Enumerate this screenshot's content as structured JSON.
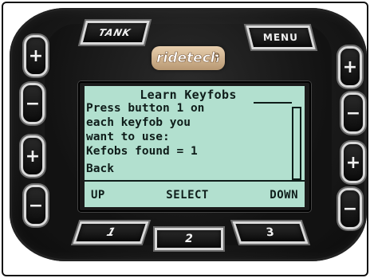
{
  "device": {
    "top_buttons": {
      "left_label": "TANK",
      "right_label": "MENU"
    },
    "brand": {
      "name": "ridetech",
      "icon": "figure-icon"
    },
    "left_buttons": [
      "+",
      "−",
      "+",
      "−"
    ],
    "right_buttons": [
      "+",
      "−",
      "+",
      "−"
    ],
    "bottom_buttons": [
      "1",
      "2",
      "3"
    ]
  },
  "lcd": {
    "title": "Learn Keyfobs",
    "lines": [
      "Press button 1 on",
      "each keyfob you",
      "want to use:",
      "Kefobs found = 1",
      "Back"
    ],
    "softkeys": {
      "left": "UP",
      "center": "SELECT",
      "right": "DOWN"
    },
    "colors": {
      "background": "#b2e0cf",
      "text": "#0f1d1a"
    }
  }
}
